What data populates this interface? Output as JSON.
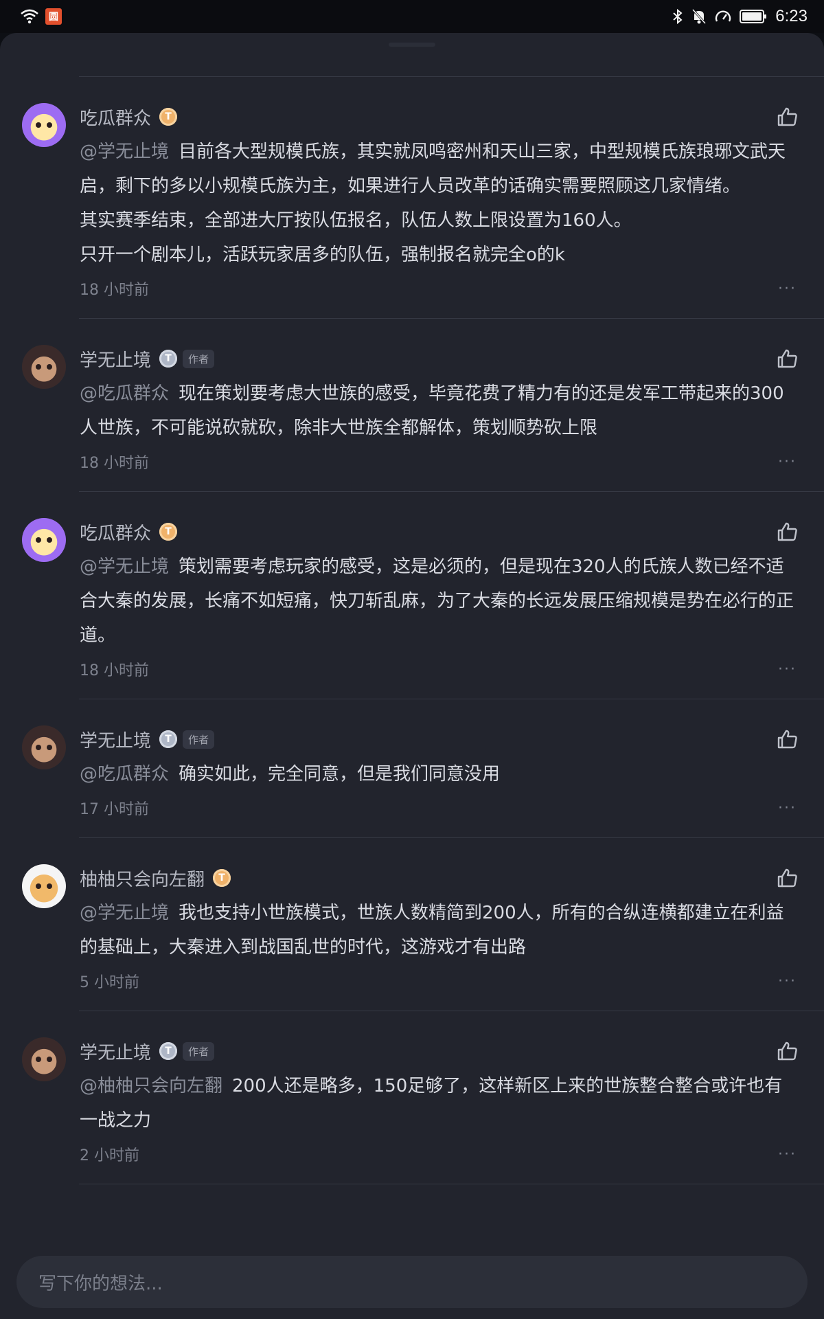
{
  "status": {
    "time": "6:23",
    "app_badge": "圆"
  },
  "comments": [
    {
      "name": "吃瓜群众",
      "level": "T",
      "is_author": false,
      "author_label": "",
      "mention": "@学无止境",
      "text": "目前各大型规模氏族，其实就凤鸣密州和天山三家，中型规模氏族琅琊文武天启，剩下的多以小规模氏族为主，如果进行人员改革的话确实需要照顾这几家情绪。\n其实赛季结束，全部进大厅按队伍报名，队伍人数上限设置为160人。\n只开一个剧本儿，活跃玩家居多的队伍，强制报名就完全o的k",
      "time": "18 小时前"
    },
    {
      "name": "学无止境",
      "level": "T",
      "is_author": true,
      "author_label": "作者",
      "mention": "@吃瓜群众",
      "text": "现在策划要考虑大世族的感受，毕竟花费了精力有的还是发军工带起来的300人世族，不可能说砍就砍，除非大世族全都解体，策划顺势砍上限",
      "time": "18 小时前"
    },
    {
      "name": "吃瓜群众",
      "level": "T",
      "is_author": false,
      "author_label": "",
      "mention": "@学无止境",
      "text": "策划需要考虑玩家的感受，这是必须的，但是现在320人的氏族人数已经不适合大秦的发展，长痛不如短痛，快刀斩乱麻，为了大秦的长远发展压缩规模是势在必行的正道。",
      "time": "18 小时前"
    },
    {
      "name": "学无止境",
      "level": "T",
      "is_author": true,
      "author_label": "作者",
      "mention": "@吃瓜群众",
      "text": "确实如此，完全同意，但是我们同意没用",
      "time": "17 小时前"
    },
    {
      "name": "柚柚只会向左翻",
      "level": "T",
      "is_author": false,
      "author_label": "",
      "mention": "@学无止境",
      "text": "我也支持小世族模式，世族人数精简到200人，所有的合纵连横都建立在利益的基础上，大秦进入到战国乱世的时代，这游戏才有出路",
      "time": "5 小时前"
    },
    {
      "name": "学无止境",
      "level": "T",
      "is_author": true,
      "author_label": "作者",
      "mention": "@柚柚只会向左翻",
      "text": "200人还是略多，150足够了，这样新区上来的世族整合整合或许也有一战之力",
      "time": "2 小时前"
    }
  ],
  "input": {
    "placeholder": "写下你的想法..."
  },
  "icons": {
    "like": "thumbs-up-icon",
    "more": "more-dots-icon"
  },
  "more_glyph": "···"
}
